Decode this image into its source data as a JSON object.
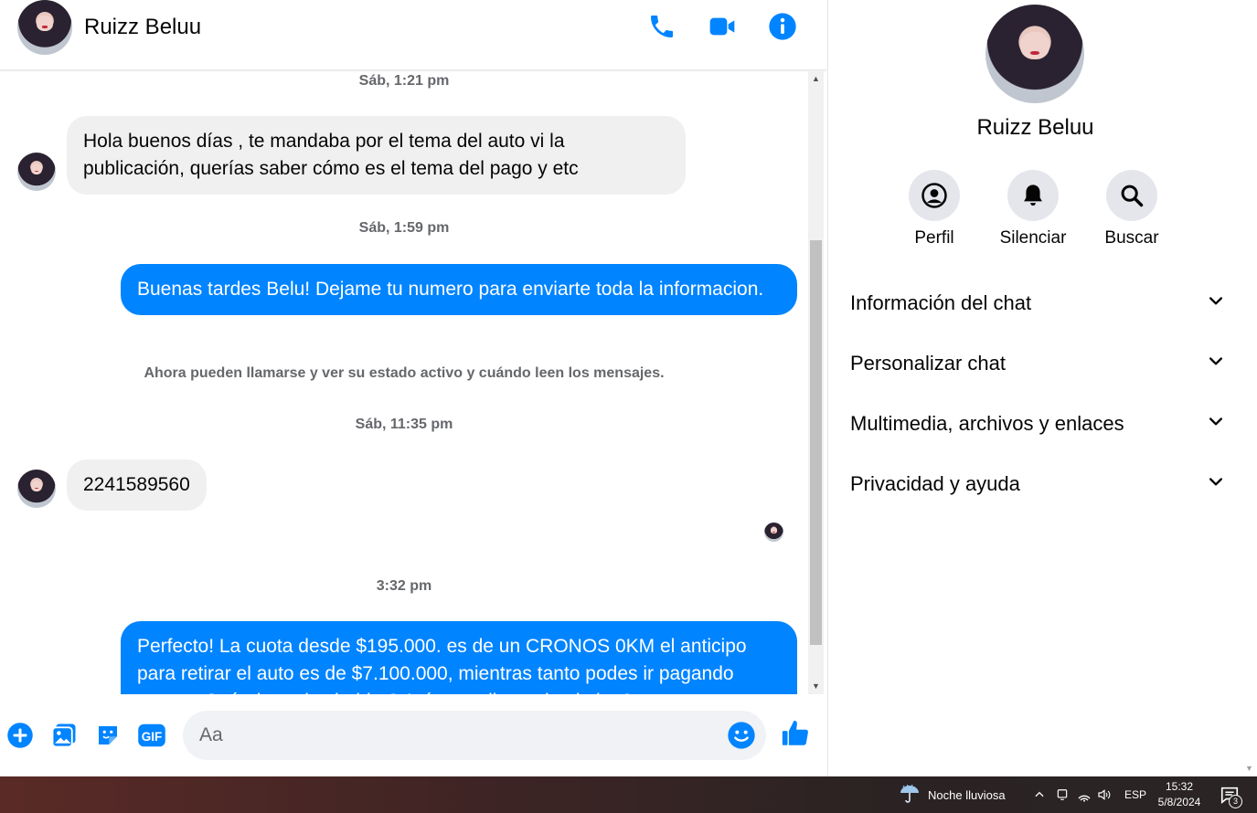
{
  "header": {
    "contact_name": "Ruizz Beluu"
  },
  "messages": {
    "ts1": "Sáb, 1:21 pm",
    "msg1": "Hola buenos días , te mandaba por el tema del auto vi la publicación, querías saber cómo es el tema del pago y etc",
    "ts2": "Sáb, 1:59 pm",
    "msg2": "Buenas tardes Belu! Dejame tu numero para enviarte toda la informacion.",
    "notice": "Ahora pueden llamarse y ver su estado activo y cuándo leen los mensajes.",
    "ts3": "Sáb, 11:35 pm",
    "msg3": "2241589560",
    "ts4": "3:32 pm",
    "msg4": "Perfecto! La cuota desde $195.000. es de un CRONOS 0KM el anticipo para retirar el auto es de $7.100.000, mientras tanto podes ir pagando cuotas. Cuándo podes hablar? Así te explico todo el plan?"
  },
  "composer": {
    "placeholder": "Aa"
  },
  "panel": {
    "name": "Ruizz Beluu",
    "actions": [
      "Perfil",
      "Silenciar",
      "Buscar"
    ],
    "sections": [
      "Información del chat",
      "Personalizar chat",
      "Multimedia, archivos y enlaces",
      "Privacidad y ayuda"
    ]
  },
  "taskbar": {
    "weather": "Noche lluviosa",
    "language": "ESP",
    "time": "15:32",
    "date": "5/8/2024",
    "notifications": "3"
  },
  "colors": {
    "accent": "#0084ff",
    "incoming_bubble": "#f0f0f0"
  }
}
